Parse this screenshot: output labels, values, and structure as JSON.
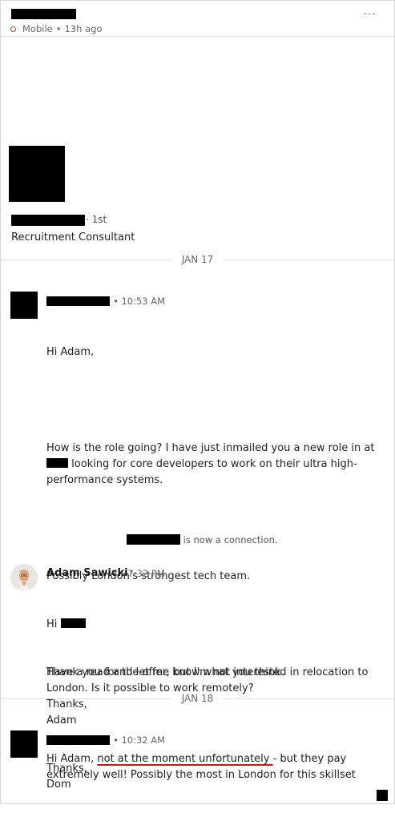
{
  "header": {
    "status": "Mobile",
    "time_ago": "13h ago",
    "more": "···"
  },
  "profile": {
    "degree": "1st",
    "headline": "Recruitment Consultant"
  },
  "dates": [
    "JAN 17",
    "JAN 18"
  ],
  "messages": [
    {
      "time": "10:53 AM",
      "greeting": "Hi Adam,",
      "para1_before": "How is the role going? I have just inmailed you a new role in at",
      "para1_after": "looking for core developers to work on their ultra high-performance systems.",
      "para2": "Possibly London's strongest tech team.",
      "para3": "Have a read and let me know what you think.",
      "sign": "Thanks,\nDom"
    },
    {
      "system": "is now a connection."
    },
    {
      "sender": "Adam Sawicki",
      "time": "7:32 PM",
      "greeting": "Hi",
      "body": "Thank you for the offer, but I'm not interested in relocation to London. Is it possible to work remotely?\nThanks,\nAdam"
    },
    {
      "time": "10:32 AM",
      "start": "Hi Adam, ",
      "underlined": "not at the moment unfortunately ",
      "rest": "- but they pay extremely well! Possibly the most in London for this skillset"
    }
  ]
}
